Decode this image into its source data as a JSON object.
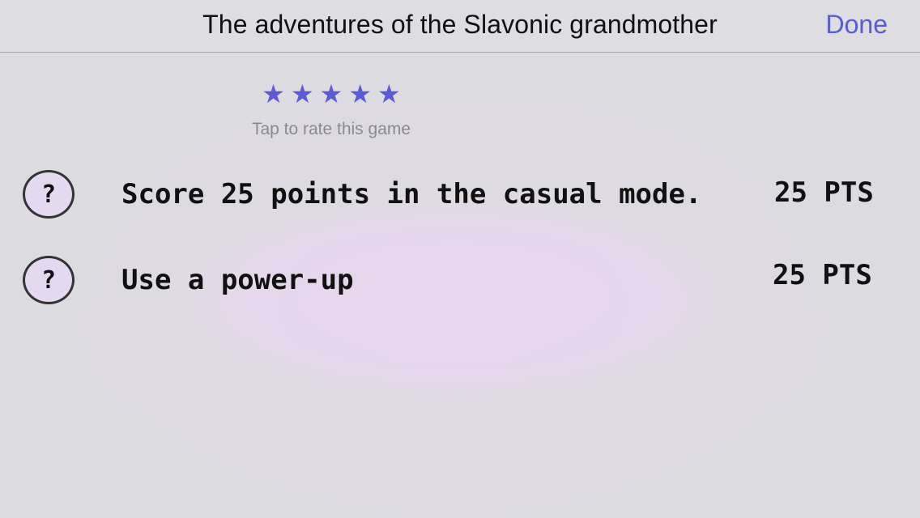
{
  "header": {
    "title": "The adventures of the Slavonic grandmother",
    "done_label": "Done"
  },
  "rating": {
    "stars": [
      "★",
      "★",
      "★",
      "★",
      "★"
    ],
    "hint": "Tap to rate this game",
    "star_color": "#5b5bd6"
  },
  "achievements": [
    {
      "icon": "?",
      "text": "Score 25 points in the casual mode.",
      "points": "25 PTS"
    },
    {
      "icon": "?",
      "text": "Use a power-up",
      "points": "25 PTS"
    }
  ],
  "colors": {
    "accent": "#5b5bd6",
    "background": "#dcdce0",
    "badge_fill": "#e4d9ee"
  }
}
